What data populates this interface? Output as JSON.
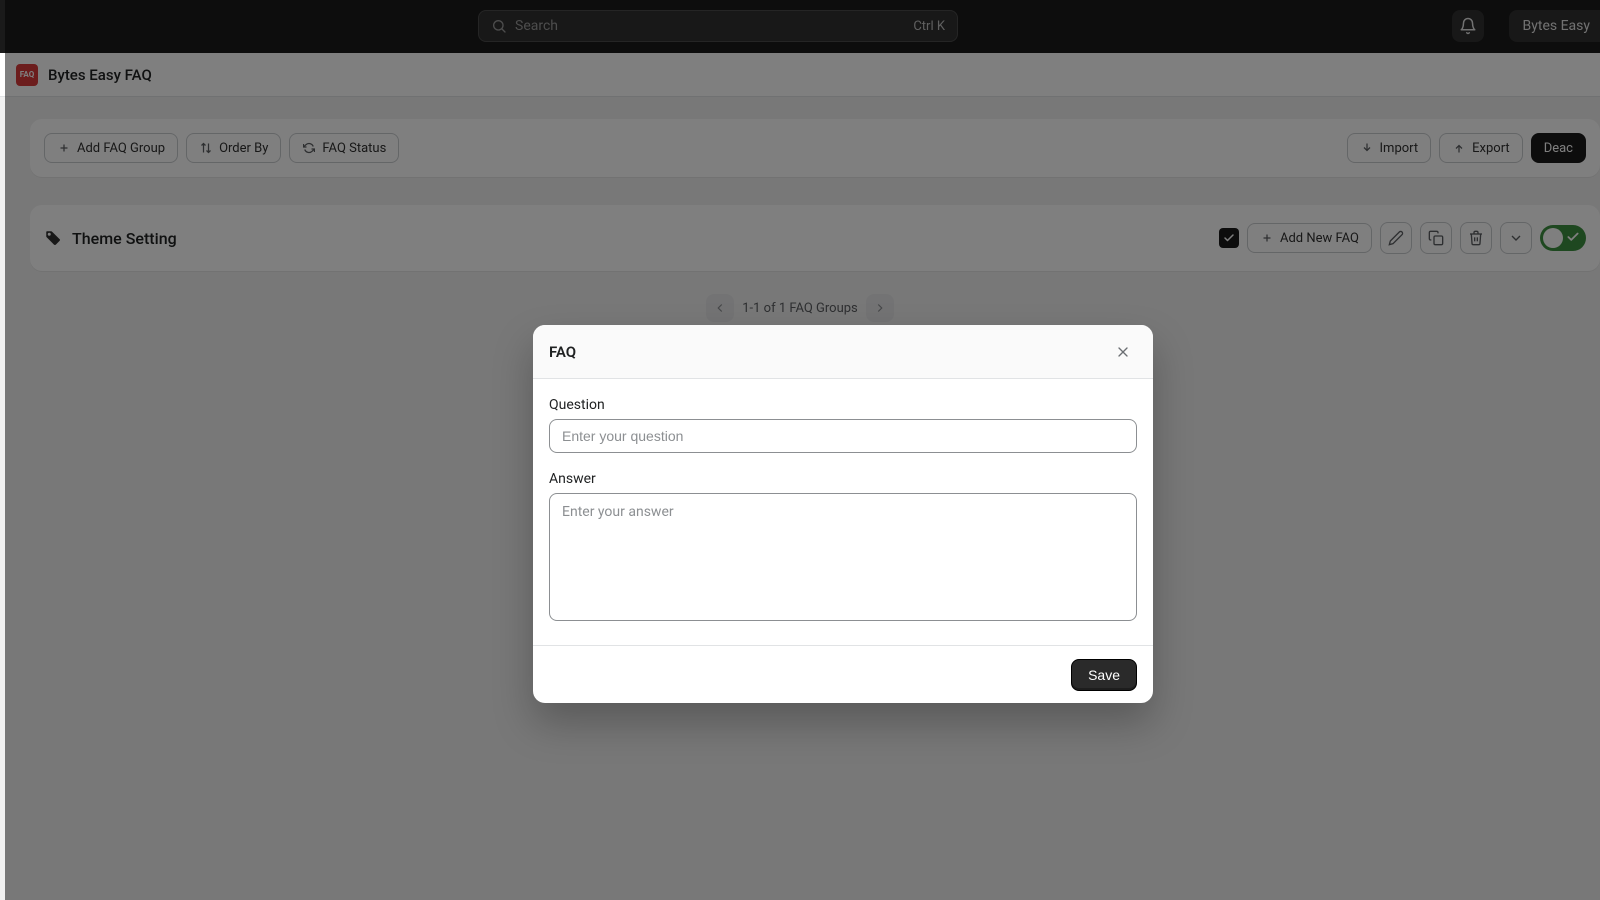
{
  "header": {
    "search_placeholder": "Search",
    "search_shortcut": "Ctrl K",
    "account_label": "Bytes Easy"
  },
  "sub_header": {
    "app_name": "Bytes Easy FAQ",
    "app_icon_text": "FAQ"
  },
  "toolbar": {
    "add_group_label": "Add FAQ Group",
    "order_by_label": "Order By",
    "faq_status_label": "FAQ Status",
    "import_label": "Import",
    "export_label": "Export",
    "deactivate_label": "Deac"
  },
  "group": {
    "title": "Theme Setting",
    "add_faq_label": "Add New FAQ",
    "checked": true,
    "toggle_on": true
  },
  "pagination": {
    "label": "1-1 of 1 FAQ Groups"
  },
  "modal": {
    "title": "FAQ",
    "question_label": "Question",
    "question_placeholder": "Enter your question",
    "question_value": "",
    "answer_label": "Answer",
    "answer_placeholder": "Enter your answer",
    "answer_value": "",
    "save_label": "Save"
  }
}
